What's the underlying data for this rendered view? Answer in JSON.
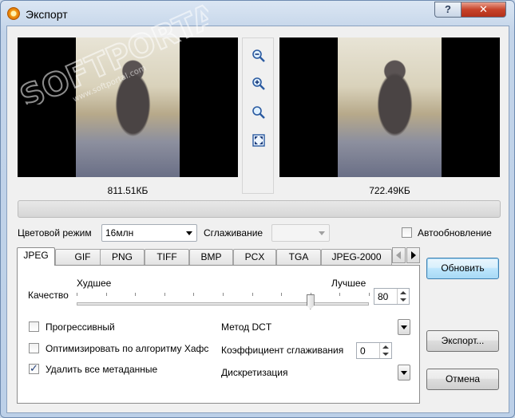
{
  "window": {
    "title": "Экспорт",
    "help_label": "?",
    "close_label": "✕"
  },
  "preview": {
    "original_size": "811.51КБ",
    "result_size": "722.49КБ",
    "zoom_icons": [
      "zoom-out-icon",
      "zoom-in-icon",
      "zoom-actual-icon",
      "fit-to-window-icon"
    ]
  },
  "progress": {
    "value": 0.0
  },
  "options": {
    "color_mode_label": "Цветовой режим",
    "color_mode_value": "16млн",
    "smoothing_label": "Сглаживание",
    "smoothing_value": "",
    "auto_update_label": "Автообновление",
    "auto_update_checked": false
  },
  "tabs": [
    {
      "label": "JPEG",
      "active": true
    },
    {
      "label": "GIF",
      "active": false
    },
    {
      "label": "PNG",
      "active": false
    },
    {
      "label": "TIFF",
      "active": false
    },
    {
      "label": "BMP",
      "active": false
    },
    {
      "label": "PCX",
      "active": false
    },
    {
      "label": "TGA",
      "active": false
    },
    {
      "label": "JPEG-2000",
      "active": false
    }
  ],
  "jpeg": {
    "quality_label": "Качество",
    "worst_label": "Худшее",
    "best_label": "Лучшее",
    "quality_value": "80",
    "quality_fraction": 0.8,
    "progressive_label": "Прогрессивный",
    "progressive_checked": false,
    "huffman_label": "Оптимизировать по алгоритму Хафс",
    "huffman_checked": false,
    "strip_meta_label": "Удалить все метаданные",
    "strip_meta_checked": true,
    "dct_label": "Метод DCT",
    "smooth_coef_label": "Коэффициент сглаживания",
    "smooth_coef_value": "0",
    "subsampling_label": "Дискретизация"
  },
  "buttons": {
    "refresh": "Обновить",
    "export": "Экспорт...",
    "cancel": "Отмена"
  },
  "watermark": {
    "brand": "SOFTPORTAL",
    "url": "www.softportal.com"
  },
  "colors": {
    "accent": "#37b34a",
    "title_bar": "#c3d4e9",
    "close_button": "#c7432a"
  }
}
